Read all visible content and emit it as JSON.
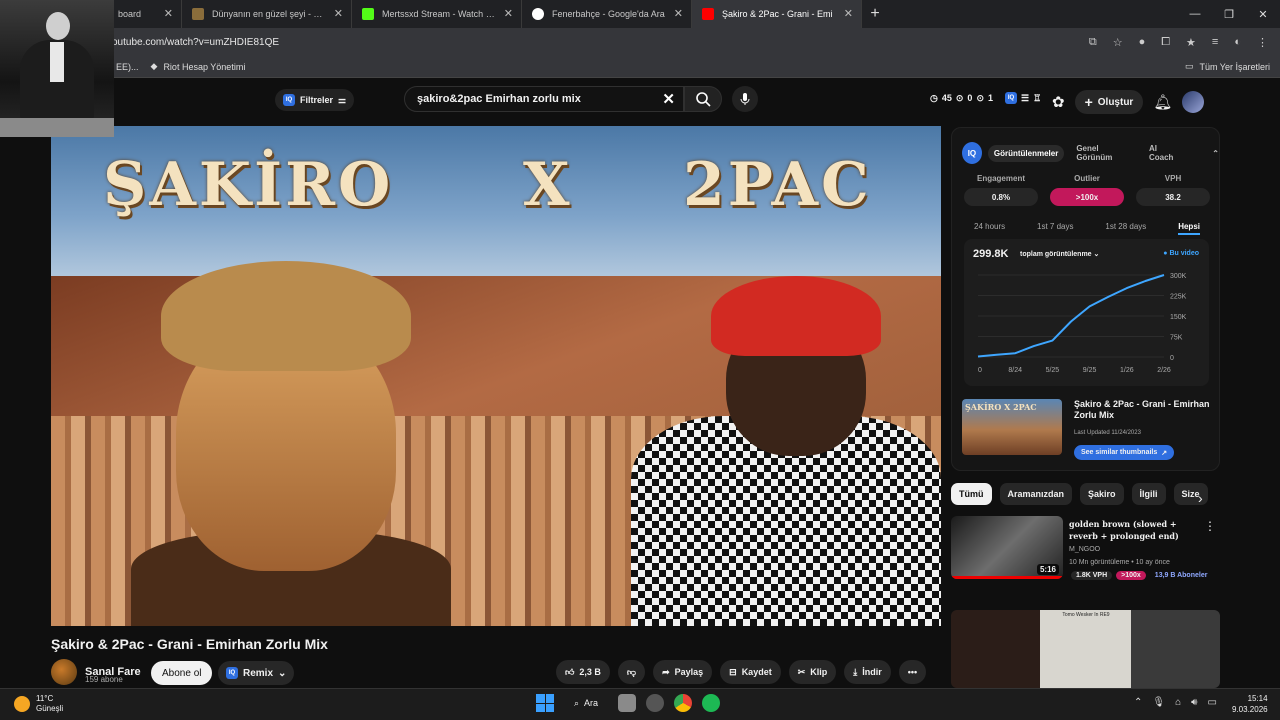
{
  "browser": {
    "tabs": [
      {
        "title": "board",
        "favicon_color": "#444444"
      },
      {
        "title": "Dünyanın en güzel şeyi - Tier L",
        "favicon_color": "#8a6d3b"
      },
      {
        "title": "Mertssxd Stream - Watch Live o",
        "favicon_color": "#53fc18"
      },
      {
        "title": "Fenerbahçe - Google'da Ara",
        "favicon_color": "#ffffff"
      },
      {
        "title": "Şakiro & 2Pac - Grani - Emi",
        "favicon_color": "#ff0000"
      }
    ],
    "url": "outube.com/watch?v=umZHDIE81QE",
    "bookmarks": [
      "EE)...",
      "Riot Hesap Yönetimi"
    ],
    "all_bookmarks": "Tüm Yer İşaretleri"
  },
  "yt": {
    "filter_label": "Filtreler",
    "search_query": "şakiro&2pac Emirhan zorlu mix",
    "stats": {
      "views": "45",
      "likes": "0",
      "comments": "1"
    },
    "create_label": "Oluştur"
  },
  "video": {
    "overlay_left": "ŞAKİRO",
    "overlay_mid": "X",
    "overlay_right": "2PAC",
    "title": "Şakiro & 2Pac - Grani - Emirhan Zorlu Mix",
    "channel": "Sanal Fare",
    "subscribers": "159 abone",
    "subscribe_label": "Abone ol",
    "remix_label": "Remix",
    "actions": {
      "likes": "2,3 B",
      "share": "Paylaş",
      "save": "Kaydet",
      "clip": "Klip",
      "download": "İndir"
    }
  },
  "panel": {
    "tabs": [
      "Görüntülenmeler",
      "Genel Görünüm",
      "AI Coach"
    ],
    "metrics": [
      {
        "label": "Engagement",
        "value": "0.8%"
      },
      {
        "label": "Outlier",
        "value": ">100x"
      },
      {
        "label": "VPH",
        "value": "38.2"
      }
    ],
    "ranges": [
      "24 hours",
      "1st 7 days",
      "1st 28 days",
      "Hepsi"
    ],
    "total": "299.8K",
    "mode": "toplam görüntülenme",
    "legend": "Bu video",
    "card_title": "Şakiro & 2Pac - Grani - Emirhan Zorlu Mix",
    "card_thumb_text": "ŞAKİRO X 2PAC",
    "last_updated": "Last Updated 11/24/2023",
    "see_similar": "See similar thumbnails"
  },
  "chart_data": {
    "type": "line",
    "title": "",
    "x": [
      "0",
      "8/24",
      "5/25",
      "9/25",
      "1/26",
      "2/26"
    ],
    "xlabel": "",
    "ylabel": "",
    "yticks": [
      "0",
      "75K",
      "150K",
      "225K",
      "300K"
    ],
    "ylim": [
      0,
      300000
    ],
    "series": [
      {
        "name": "Bu video",
        "points": [
          [
            0,
            2000
          ],
          [
            0.5,
            8000
          ],
          [
            1,
            14000
          ],
          [
            1.5,
            40000
          ],
          [
            2,
            60000
          ],
          [
            2.5,
            130000
          ],
          [
            3,
            185000
          ],
          [
            3.5,
            220000
          ],
          [
            4,
            252000
          ],
          [
            4.5,
            278000
          ],
          [
            5,
            300000
          ]
        ]
      }
    ],
    "color": "#3ea6ff",
    "grid": true
  },
  "chips": [
    "Tümü",
    "Aramanızdan",
    "Şakiro",
    "İlgili",
    "Size"
  ],
  "recommended": {
    "title": "golden brown (slowed + reverb + prolonged end)",
    "channel": "M_NGOO",
    "meta": "10 Mn görüntüleme • 10 ay önce",
    "duration": "5:16",
    "vph": "1.8K VPH",
    "outlier": ">100x",
    "subs": "13,9 B Aboneler",
    "second_caption": "Tomo Wesker In RE9"
  },
  "taskbar": {
    "temp": "11°C",
    "weather": "Güneşli",
    "search": "Ara",
    "time": "15:14",
    "date": "9.03.2026"
  }
}
